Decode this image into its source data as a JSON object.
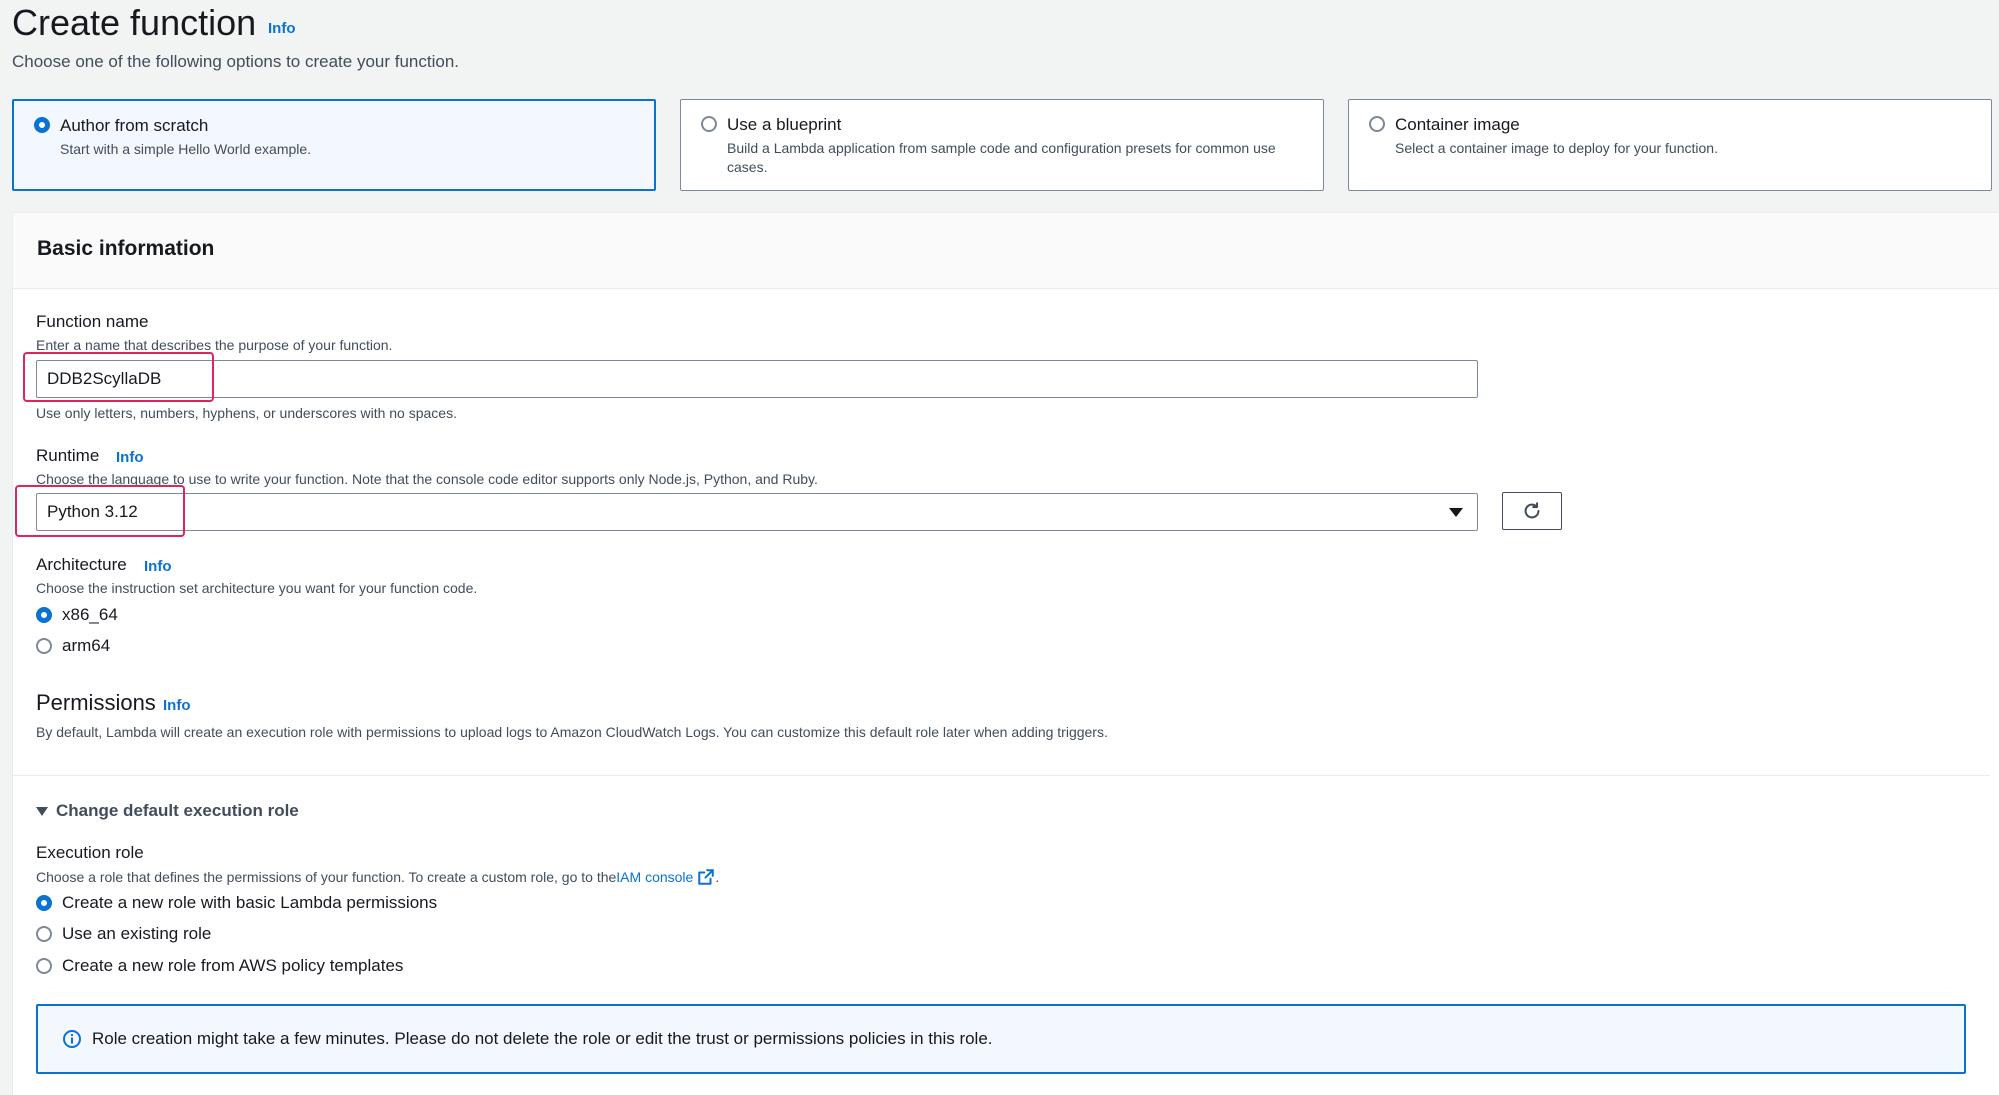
{
  "header": {
    "title": "Create function",
    "info": "Info",
    "subtitle": "Choose one of the following options to create your function."
  },
  "options": [
    {
      "title": "Author from scratch",
      "desc": "Start with a simple Hello World example.",
      "selected": true
    },
    {
      "title": "Use a blueprint",
      "desc": "Build a Lambda application from sample code and configuration presets for common use cases.",
      "selected": false
    },
    {
      "title": "Container image",
      "desc": "Select a container image to deploy for your function.",
      "selected": false
    }
  ],
  "basic_info": {
    "title": "Basic information",
    "function_name": {
      "label": "Function name",
      "desc": "Enter a name that describes the purpose of your function.",
      "value": "DDB2ScyllaDB",
      "constraint": "Use only letters, numbers, hyphens, or underscores with no spaces."
    },
    "runtime": {
      "label": "Runtime",
      "info": "Info",
      "desc": "Choose the language to use to write your function. Note that the console code editor supports only Node.js, Python, and Ruby.",
      "value": "Python 3.12"
    },
    "architecture": {
      "label": "Architecture",
      "info": "Info",
      "desc": "Choose the instruction set architecture you want for your function code.",
      "options": [
        "x86_64",
        "arm64"
      ],
      "selected": "x86_64"
    },
    "permissions": {
      "title": "Permissions",
      "info": "Info",
      "desc": "By default, Lambda will create an execution role with permissions to upload logs to Amazon CloudWatch Logs. You can customize this default role later when adding triggers."
    },
    "execution_role": {
      "expander": "Change default execution role",
      "label": "Execution role",
      "desc_prefix": "Choose a role that defines the permissions of your function. To create a custom role, go to the ",
      "desc_link": "IAM console",
      "desc_suffix": ".",
      "options": [
        "Create a new role with basic Lambda permissions",
        "Use an existing role",
        "Create a new role from AWS policy templates"
      ],
      "selected": "Create a new role with basic Lambda permissions"
    },
    "alert": "Role creation might take a few minutes. Please do not delete the role or edit the trust or permissions policies in this role."
  },
  "icons": {
    "refresh": "refresh-icon",
    "dropdown": "caret-down-icon",
    "external": "external-link-icon",
    "info": "info-circle-icon",
    "expand": "caret-down-filled-icon"
  },
  "colors": {
    "accent": "#0972d3",
    "highlight": "#e0245e"
  }
}
